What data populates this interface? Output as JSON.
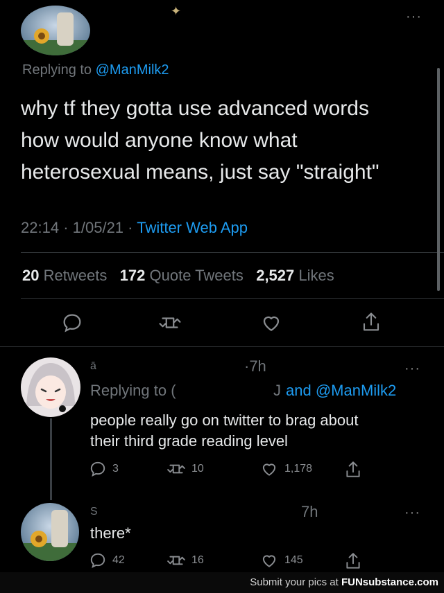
{
  "main_tweet": {
    "replying_prefix": "Replying to",
    "replying_handle": "@ManMilk2",
    "text_lines": [
      "why tf they gotta use advanced words",
      "how would anyone know what",
      "heterosexual means, just say \"straight\""
    ],
    "time": "22:14",
    "date": "1/05/21",
    "source": "Twitter Web App",
    "dot_sep": "·",
    "stats": {
      "retweets_count": "20",
      "retweets_label": "Retweets",
      "quotes_count": "172",
      "quotes_label": "Quote Tweets",
      "likes_count": "2,527",
      "likes_label": "Likes"
    },
    "more": "···"
  },
  "reply1": {
    "handle_fragment": "ā",
    "time": "·7h",
    "replying_prefix": "Replying to",
    "replying_mid_fragment": "(",
    "replying_second_fragment": "J",
    "replying_and": "and @ManMilk2",
    "text_lines": [
      "people really go on twitter to brag about",
      "their third grade reading level"
    ],
    "replies": "3",
    "retweets": "10",
    "likes": "1,178",
    "more": "···"
  },
  "reply2": {
    "handle_fragment": "S",
    "time": "7h",
    "text": "there*",
    "replies": "42",
    "retweets": "16",
    "likes": "145",
    "more": "···"
  },
  "footer": {
    "label": "Submit your pics at",
    "brand": "FUNsubstance.com"
  },
  "colors": {
    "background": "#000000",
    "text": "#e7e9ea",
    "muted": "#71767b",
    "link": "#1d9bf0"
  }
}
